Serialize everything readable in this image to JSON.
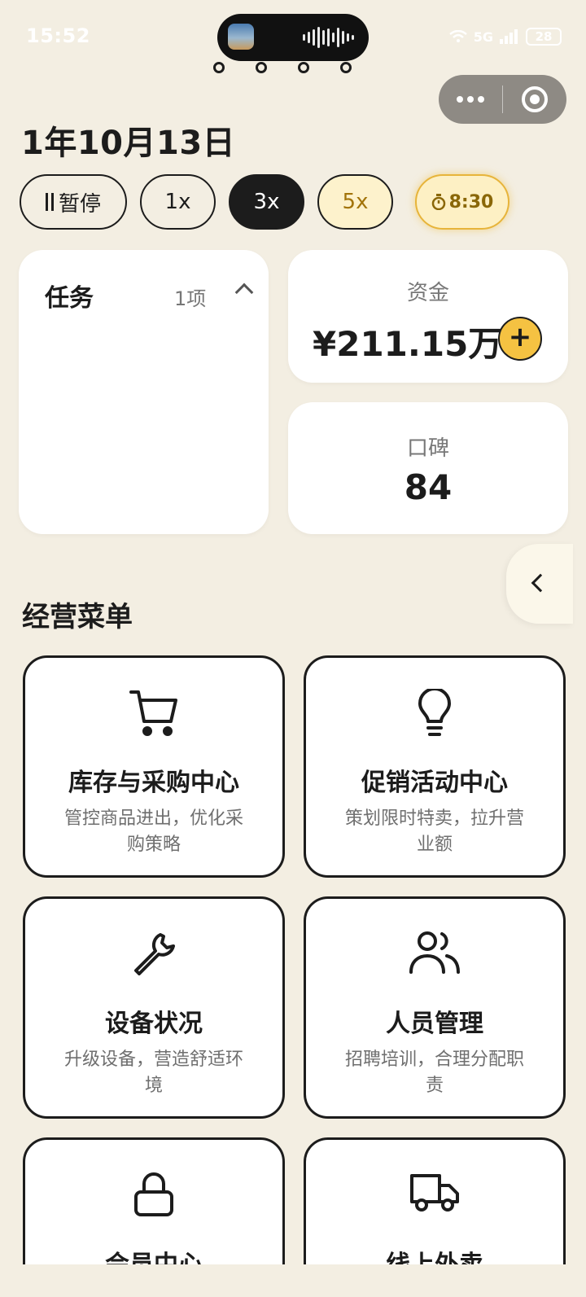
{
  "status_bar": {
    "time": "15:52",
    "network": "5G",
    "battery": "28"
  },
  "capsule": {
    "more_icon": "more-dots-icon",
    "close_icon": "target-icon"
  },
  "date": "1年10月13日",
  "speed_controls": {
    "pause": "暂停",
    "speed_1": "1x",
    "speed_3": "3x",
    "speed_5": "5x",
    "timer": "8:30",
    "selected": "3x"
  },
  "tasks": {
    "title": "任务",
    "count": "1项"
  },
  "funds": {
    "label": "资金",
    "value": "¥211.15万",
    "add_label": "+"
  },
  "reputation": {
    "label": "口碑",
    "value": "84"
  },
  "menu": {
    "title": "经营菜单",
    "items": [
      {
        "name": "库存与采购中心",
        "desc": "管控商品进出，优化采购策略",
        "icon": "cart-icon"
      },
      {
        "name": "促销活动中心",
        "desc": "策划限时特卖，拉升营业额",
        "icon": "lightbulb-icon"
      },
      {
        "name": "设备状况",
        "desc": "升级设备，营造舒适环境",
        "icon": "wrench-icon"
      },
      {
        "name": "人员管理",
        "desc": "招聘培训，合理分配职责",
        "icon": "users-icon"
      },
      {
        "name": "会员中心",
        "desc": "",
        "icon": "lock-icon"
      },
      {
        "name": "线上外卖",
        "desc": "",
        "icon": "truck-icon"
      }
    ]
  }
}
